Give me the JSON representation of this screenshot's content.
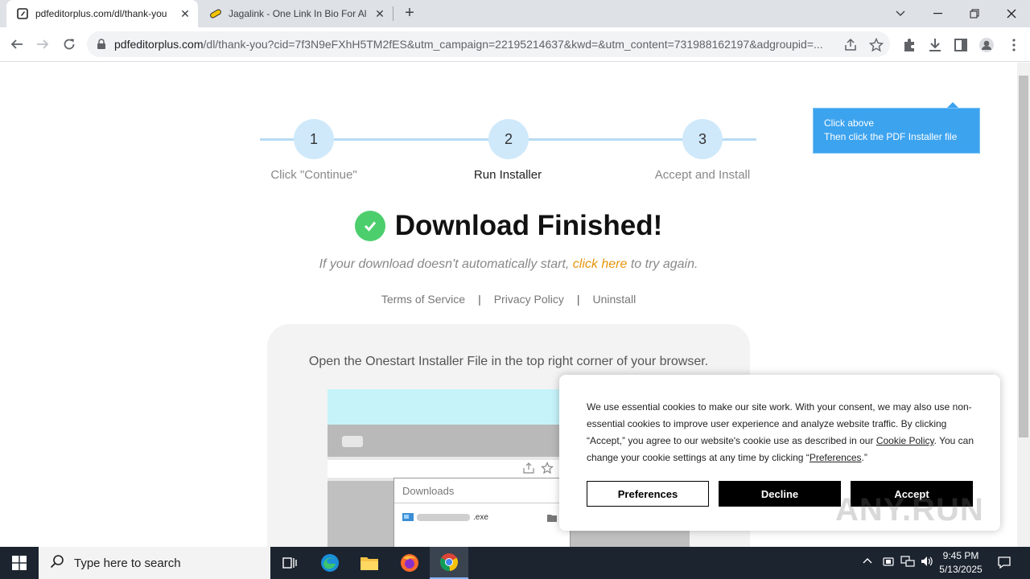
{
  "browser": {
    "tabs": [
      {
        "title": "pdfeditorplus.com/dl/thank-you",
        "active": true
      },
      {
        "title": "Jagalink - One Link In Bio For All",
        "active": false
      }
    ],
    "url_host": "pdfeditorplus.com",
    "url_rest": "/dl/thank-you?cid=7f3N9eFXhH5TM2fES&utm_campaign=22195214637&kwd=&utm_content=731988162197&adgroupid=..."
  },
  "steps": [
    {
      "number": "1",
      "label": "Click \"Continue\""
    },
    {
      "number": "2",
      "label": "Run Installer"
    },
    {
      "number": "3",
      "label": "Accept and Install"
    }
  ],
  "headline": "Download Finished!",
  "subtext": {
    "before": "If your download doesn't automatically start,",
    "link": "click here",
    "after": "to try again."
  },
  "footer_links": {
    "terms": "Terms of Service",
    "privacy": "Privacy Policy",
    "uninstall": "Uninstall",
    "separator": "|"
  },
  "instructions": "Open the Onestart Installer File in the top right corner of your browser.",
  "mockup": {
    "downloads_title": "Downloads",
    "file_suffix": ".exe"
  },
  "tooltip": {
    "line1": "Click above",
    "line2": "Then click the PDF Installer file"
  },
  "cookie": {
    "text_1": "We use essential cookies to make our site work. With your consent, we may also use non-essential cookies to improve user experience and analyze website traffic. By clicking “Accept,” you agree to our website's cookie use as described in our ",
    "cookie_policy_link": "Cookie Policy",
    "text_2": ". You can change your cookie settings at any time by clicking “",
    "preferences_link": "Preferences",
    "text_3": ".”",
    "preferences_button": "Preferences",
    "decline_button": "Decline",
    "accept_button": "Accept"
  },
  "watermark": "ANY.RUN",
  "taskbar": {
    "search_placeholder": "Type here to search",
    "time": "9:45 PM",
    "date": "5/13/2025"
  },
  "colors": {
    "step_circle": "#cfe9fb",
    "check_green": "#4cce6c",
    "link_orange": "#e8950a",
    "tooltip_blue": "#3ca3ef"
  }
}
